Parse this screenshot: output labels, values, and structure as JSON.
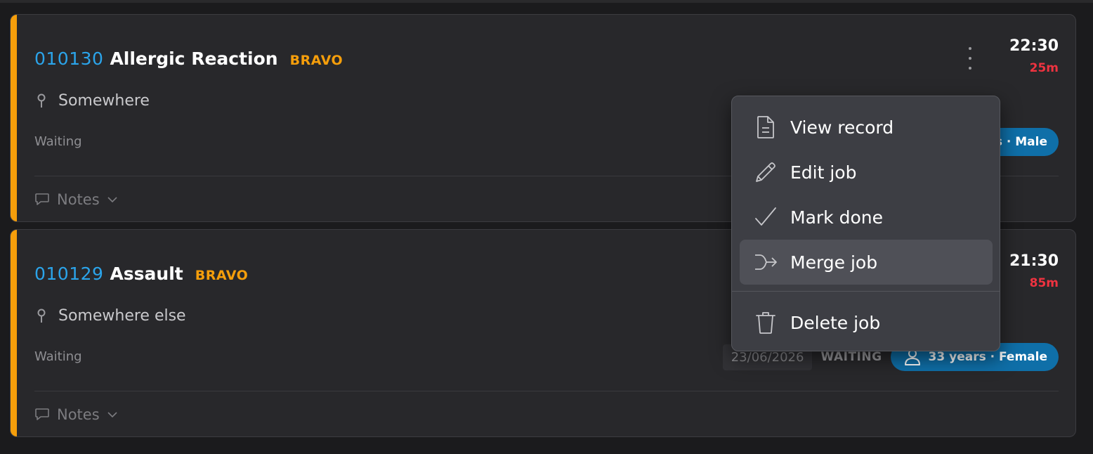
{
  "jobs": [
    {
      "id": "010130",
      "title": "Allergic Reaction",
      "tag": "BRAVO",
      "location": "Somewhere",
      "status": "Waiting",
      "time": "22:30",
      "elapsed": "25m",
      "patient": "s · Male",
      "notes_label": "Notes"
    },
    {
      "id": "010129",
      "title": "Assault",
      "tag": "BRAVO",
      "location": "Somewhere else",
      "status": "Waiting",
      "time": "21:30",
      "elapsed": "85m",
      "date": "23/06/2026",
      "state": "WAITING",
      "patient": "33 years · Female",
      "notes_label": "Notes"
    }
  ],
  "menu": {
    "items": [
      {
        "label": "View record",
        "icon": "document-icon"
      },
      {
        "label": "Edit job",
        "icon": "pencil-icon"
      },
      {
        "label": "Mark done",
        "icon": "check-icon"
      },
      {
        "label": "Merge job",
        "icon": "merge-icon",
        "hovered": true
      },
      {
        "label": "Delete job",
        "icon": "trash-icon"
      }
    ]
  },
  "colors": {
    "accent": "#f59e0b",
    "job_id": "#2ba4ea",
    "elapsed": "#ef3340",
    "pill": "#0f6fa8",
    "menu_bg": "#3d3e44"
  }
}
